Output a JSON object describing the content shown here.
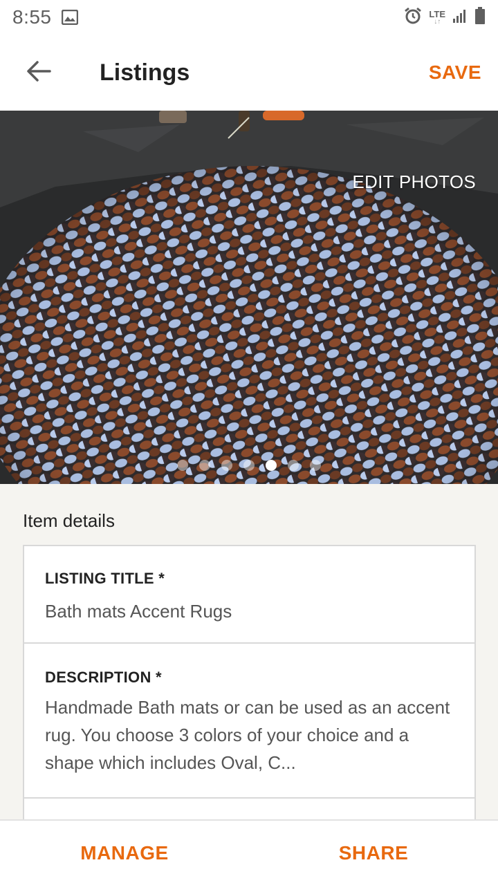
{
  "status_bar": {
    "time": "8:55",
    "network": "LTE",
    "network_arrows": "↓↑",
    "icons": [
      "image-icon",
      "alarm-icon",
      "signal-icon",
      "battery-icon"
    ]
  },
  "app_bar": {
    "back_icon": "back-arrow-icon",
    "title": "Listings",
    "save_label": "SAVE"
  },
  "photo": {
    "edit_label": "EDIT PHOTOS",
    "description": "",
    "photo_count": 7,
    "active_index": 4
  },
  "item_details": {
    "heading": "Item details",
    "listing_title": {
      "label": "LISTING TITLE *",
      "value": "Bath mats  Accent Rugs"
    },
    "description": {
      "label": "DESCRIPTION *",
      "value": "Handmade Bath mats or can be used as an accent rug. You choose 3 colors of your choice and a shape which includes Oval, C..."
    }
  },
  "bottom_bar": {
    "manage_label": "MANAGE",
    "share_label": "SHARE"
  },
  "colors": {
    "accent": "#e8690f",
    "status_text": "#5f5f5f",
    "title_text": "#222222"
  }
}
